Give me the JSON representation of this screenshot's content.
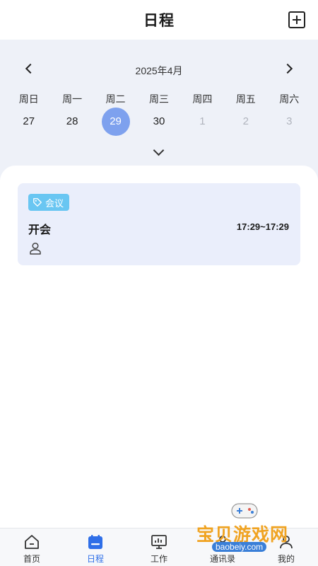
{
  "header": {
    "title": "日程"
  },
  "calendar": {
    "month_label": "2025年4月",
    "weekdays": [
      "周日",
      "周一",
      "周二",
      "周三",
      "周四",
      "周五",
      "周六"
    ],
    "days": [
      "27",
      "28",
      "29",
      "30",
      "1",
      "2",
      "3"
    ],
    "selected_index": 2,
    "accent_color": "#7ea1ee"
  },
  "event": {
    "tag": "会议",
    "title": "开会",
    "time": "17:29~17:29",
    "tag_color": "#69c6f2",
    "card_color": "#eaeefb"
  },
  "tabbar": {
    "items": [
      {
        "label": "首页",
        "icon": "home-icon"
      },
      {
        "label": "日程",
        "icon": "calendar-icon"
      },
      {
        "label": "工作",
        "icon": "monitor-icon"
      },
      {
        "label": "通讯录",
        "icon": "contacts-icon"
      },
      {
        "label": "我的",
        "icon": "user-icon"
      }
    ],
    "active_color": "#2f6fe8"
  },
  "watermark": {
    "text": "宝贝游戏网",
    "url": "baobeiy.com"
  }
}
